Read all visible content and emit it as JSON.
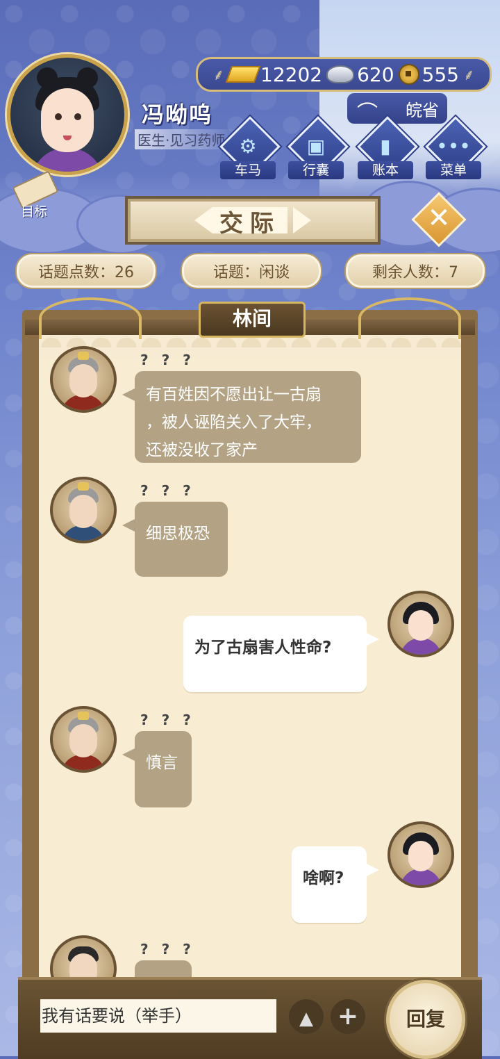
{
  "player": {
    "name": "冯呦呜",
    "title": "医生·见习药师"
  },
  "currency": {
    "gold": "12202",
    "silver": "620",
    "copper": "555"
  },
  "region": "皖省",
  "nav": [
    {
      "label": "车马",
      "icon": "carriage-icon"
    },
    {
      "label": "行囊",
      "icon": "bag-icon"
    },
    {
      "label": "账本",
      "icon": "ledger-icon"
    },
    {
      "label": "菜单",
      "icon": "menu-dots-icon"
    }
  ],
  "goal_label": "目标",
  "scene_title": "交际",
  "stats": {
    "topic_points": "话题点数：26",
    "topic": "话题：闲谈",
    "remaining": "剩余人数：7"
  },
  "location": "林间",
  "messages": [
    {
      "side": "left",
      "speaker": "? ? ?",
      "lines": [
        "有百姓因不愿出让一古扇",
        "，被人诬陷关入了大牢，",
        "还被没收了家产"
      ]
    },
    {
      "side": "left",
      "speaker": "? ? ?",
      "lines": [
        "细思极恐"
      ]
    },
    {
      "side": "right",
      "lines": [
        "为了古扇害人性命?"
      ]
    },
    {
      "side": "left",
      "speaker": "? ? ?",
      "lines": [
        "慎言"
      ]
    },
    {
      "side": "right",
      "lines": [
        "啥啊?"
      ]
    },
    {
      "side": "left",
      "speaker": "? ? ?",
      "lines": [
        ""
      ]
    }
  ],
  "input": {
    "placeholder": "我有话要说（举手）"
  },
  "reply_label": "回复"
}
